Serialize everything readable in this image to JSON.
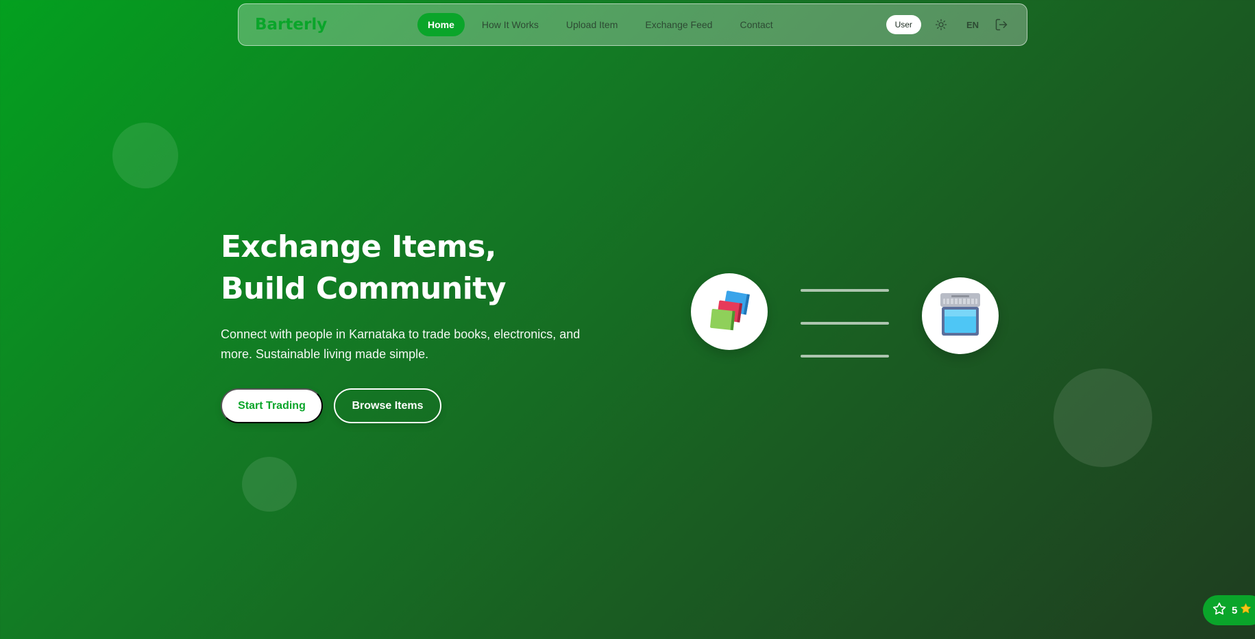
{
  "brand": {
    "name": "Barterly",
    "color": "#0aa52a"
  },
  "nav": {
    "items": [
      {
        "label": "Home",
        "active": true
      },
      {
        "label": "How It Works"
      },
      {
        "label": "Upload Item"
      },
      {
        "label": "Exchange Feed"
      },
      {
        "label": "Contact"
      }
    ],
    "user_label": "User",
    "theme_icon": "sun-icon",
    "language": "EN",
    "logout_icon": "logout-icon"
  },
  "hero": {
    "title_line1": "Exchange Items,",
    "title_line2": "Build Community",
    "subtitle": "Connect with people in Karnataka to trade books, electronics, and more. Sustainable living made simple.",
    "primary_button": "Start Trading",
    "secondary_button": "Browse Items"
  },
  "illustration": {
    "left_icon": "books-icon",
    "right_icon": "laptop-icon"
  },
  "rating_widget": {
    "count": "5",
    "icon": "star-icon"
  }
}
